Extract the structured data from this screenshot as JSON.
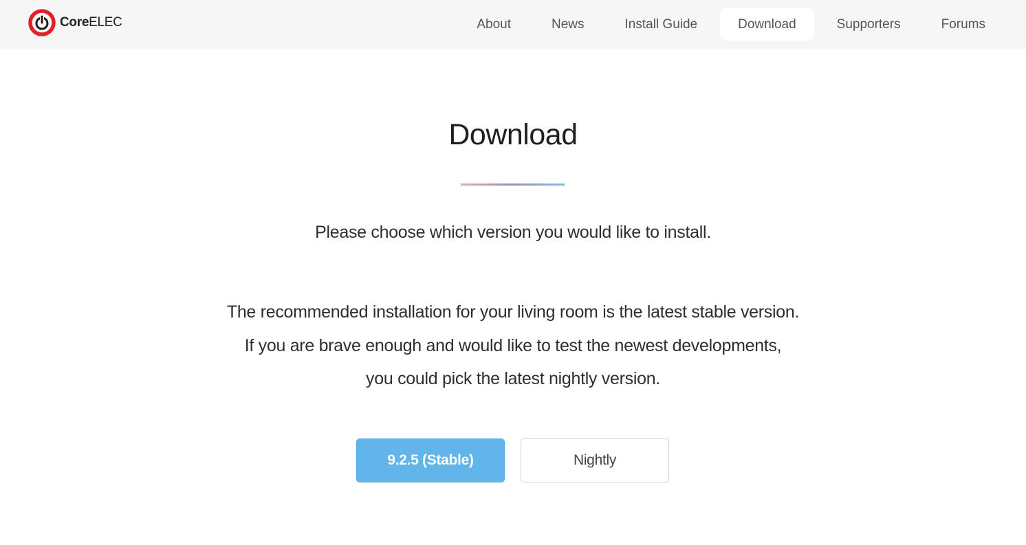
{
  "brand": {
    "name_bold": "Core",
    "name_rest": "ELEC",
    "logo_icon": "power-icon",
    "logo_color": "#e3202a"
  },
  "nav": {
    "items": [
      {
        "label": "About"
      },
      {
        "label": "News"
      },
      {
        "label": "Install Guide"
      },
      {
        "label": "Download",
        "active": true
      },
      {
        "label": "Supporters"
      },
      {
        "label": "Forums"
      }
    ]
  },
  "main": {
    "title": "Download",
    "lead": "Please choose which version you would like to install.",
    "description": [
      "The recommended installation for your living room is the latest stable version.",
      "If you are brave enough and would like to test the newest developments,",
      "you could pick the latest nightly version."
    ],
    "buttons": {
      "stable_label": "9.2.5 (Stable)",
      "nightly_label": "Nightly"
    }
  },
  "colors": {
    "accent": "#62b5eb",
    "navbar_bg": "#f6f6f6"
  }
}
